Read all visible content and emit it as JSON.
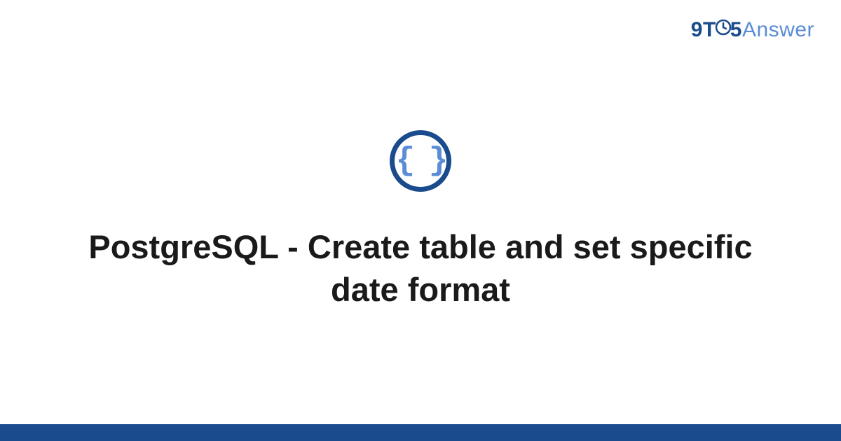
{
  "logo": {
    "part1": "9",
    "part2": "T",
    "part3": "5",
    "part4": "Answer"
  },
  "icon": {
    "content": "{ }"
  },
  "main": {
    "title": "PostgreSQL - Create table and set specific date format"
  },
  "colors": {
    "primary": "#1a4b8c",
    "secondary": "#5a8dd6"
  }
}
